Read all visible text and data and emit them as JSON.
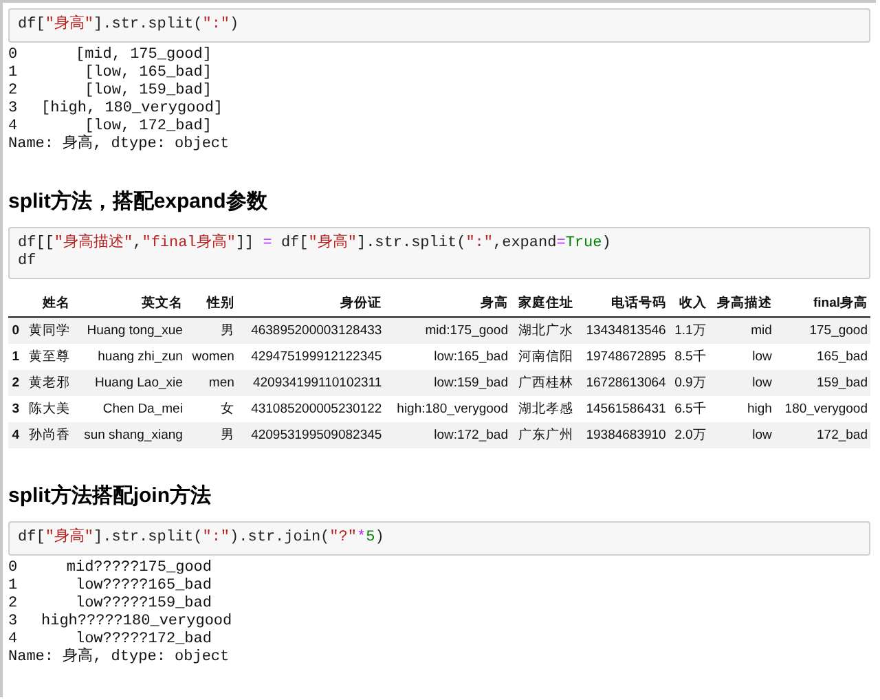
{
  "cells": [
    {
      "kind": "code",
      "code_lines": [
        [
          {
            "t": "df[",
            "kind": "plain"
          },
          {
            "t": "\"身高\"",
            "kind": "string"
          },
          {
            "t": "].str.split(",
            "kind": "plain"
          },
          {
            "t": "\":\"",
            "kind": "string"
          },
          {
            "t": ")",
            "kind": "plain"
          }
        ]
      ],
      "output": {
        "rows": [
          {
            "index": "0",
            "value": "[mid, 175_good]"
          },
          {
            "index": "1",
            "value": "[low, 165_bad]"
          },
          {
            "index": "2",
            "value": "[low, 159_bad]"
          },
          {
            "index": "3",
            "value": "[high, 180_verygood]"
          },
          {
            "index": "4",
            "value": "[low, 172_bad]"
          }
        ],
        "footer": "Name: 身高, dtype: object"
      }
    },
    {
      "kind": "heading",
      "text": "split方法，搭配expand参数"
    },
    {
      "kind": "code",
      "code_lines": [
        [
          {
            "t": "df[[",
            "kind": "plain"
          },
          {
            "t": "\"身高描述\"",
            "kind": "string"
          },
          {
            "t": ",",
            "kind": "plain"
          },
          {
            "t": "\"final身高\"",
            "kind": "string"
          },
          {
            "t": "]] ",
            "kind": "plain"
          },
          {
            "t": "=",
            "kind": "operator"
          },
          {
            "t": " df[",
            "kind": "plain"
          },
          {
            "t": "\"身高\"",
            "kind": "string"
          },
          {
            "t": "].str.split(",
            "kind": "plain"
          },
          {
            "t": "\":\"",
            "kind": "string"
          },
          {
            "t": ",expand",
            "kind": "plain"
          },
          {
            "t": "=",
            "kind": "operator"
          },
          {
            "t": "True",
            "kind": "keyword"
          },
          {
            "t": ")",
            "kind": "plain"
          }
        ],
        [
          {
            "t": "df",
            "kind": "plain"
          }
        ]
      ],
      "table": {
        "columns": [
          "",
          "姓名",
          "英文名",
          "性别",
          "身份证",
          "身高",
          "家庭住址",
          "电话号码",
          "收入",
          "身高描述",
          "final身高"
        ],
        "rows": [
          [
            "0",
            "黄同学",
            "Huang tong_xue",
            "男",
            "463895200003128433",
            "mid:175_good",
            "湖北广水",
            "13434813546",
            "1.1万",
            "mid",
            "175_good"
          ],
          [
            "1",
            "黄至尊",
            "huang zhi_zun",
            "women",
            "429475199912122345",
            "low:165_bad",
            "河南信阳",
            "19748672895",
            "8.5千",
            "low",
            "165_bad"
          ],
          [
            "2",
            "黄老邪",
            "Huang Lao_xie",
            "men",
            "420934199110102311",
            "low:159_bad",
            "广西桂林",
            "16728613064",
            "0.9万",
            "low",
            "159_bad"
          ],
          [
            "3",
            "陈大美",
            "Chen Da_mei",
            "女",
            "431085200005230122",
            "high:180_verygood",
            "湖北孝感",
            "14561586431",
            "6.5千",
            "high",
            "180_verygood"
          ],
          [
            "4",
            "孙尚香",
            "sun shang_xiang",
            "男",
            "420953199509082345",
            "low:172_bad",
            "广东广州",
            "19384683910",
            "2.0万",
            "low",
            "172_bad"
          ]
        ]
      }
    },
    {
      "kind": "heading",
      "text": "split方法搭配join方法"
    },
    {
      "kind": "code",
      "code_lines": [
        [
          {
            "t": "df[",
            "kind": "plain"
          },
          {
            "t": "\"身高\"",
            "kind": "string"
          },
          {
            "t": "].str.split(",
            "kind": "plain"
          },
          {
            "t": "\":\"",
            "kind": "string"
          },
          {
            "t": ").str.join(",
            "kind": "plain"
          },
          {
            "t": "\"?\"",
            "kind": "string"
          },
          {
            "t": "*",
            "kind": "operator"
          },
          {
            "t": "5",
            "kind": "keyword"
          },
          {
            "t": ")",
            "kind": "plain"
          }
        ]
      ],
      "output": {
        "rows": [
          {
            "index": "0",
            "value": "mid?????175_good"
          },
          {
            "index": "1",
            "value": "low?????165_bad"
          },
          {
            "index": "2",
            "value": "low?????159_bad"
          },
          {
            "index": "3",
            "value": "high?????180_verygood"
          },
          {
            "index": "4",
            "value": "low?????172_bad"
          }
        ],
        "footer": "Name: 身高, dtype: object"
      }
    }
  ]
}
